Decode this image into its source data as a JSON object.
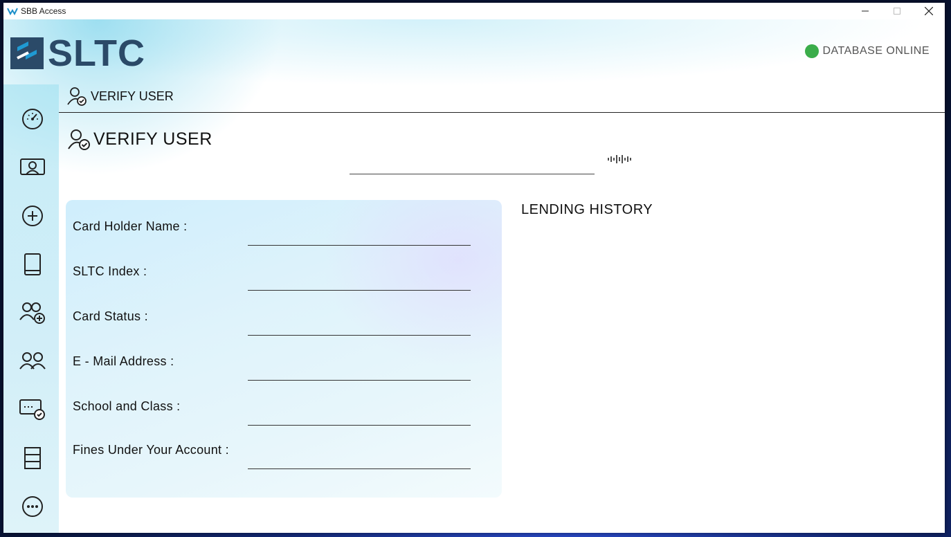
{
  "window": {
    "title": "SBB Access"
  },
  "header": {
    "logo_text": "SLTC",
    "db_status": "DATABASE ONLINE",
    "db_status_color": "#3aad4a"
  },
  "breadcrumb": {
    "label": "VERIFY USER"
  },
  "page": {
    "heading": "VERIFY USER",
    "scan_value": ""
  },
  "sidebar": {
    "items": [
      {
        "icon": "dashboard-icon"
      },
      {
        "icon": "user-presentation-icon"
      },
      {
        "icon": "add-circle-icon"
      },
      {
        "icon": "book-icon"
      },
      {
        "icon": "add-users-icon"
      },
      {
        "icon": "users-icon"
      },
      {
        "icon": "verify-card-icon"
      },
      {
        "icon": "list-icon"
      },
      {
        "icon": "more-icon"
      }
    ]
  },
  "card": {
    "fields": [
      {
        "label": "Card Holder Name :",
        "value": ""
      },
      {
        "label": "SLTC Index :",
        "value": ""
      },
      {
        "label": "Card Status :",
        "value": ""
      },
      {
        "label": "E - Mail Address :",
        "value": ""
      },
      {
        "label": "School and Class :",
        "value": ""
      },
      {
        "label": "Fines Under Your Account :",
        "value": ""
      }
    ]
  },
  "lending": {
    "title": "LENDING HISTORY"
  },
  "colors": {
    "logo_accent": "#2b4a68",
    "online": "#3aad4a"
  }
}
